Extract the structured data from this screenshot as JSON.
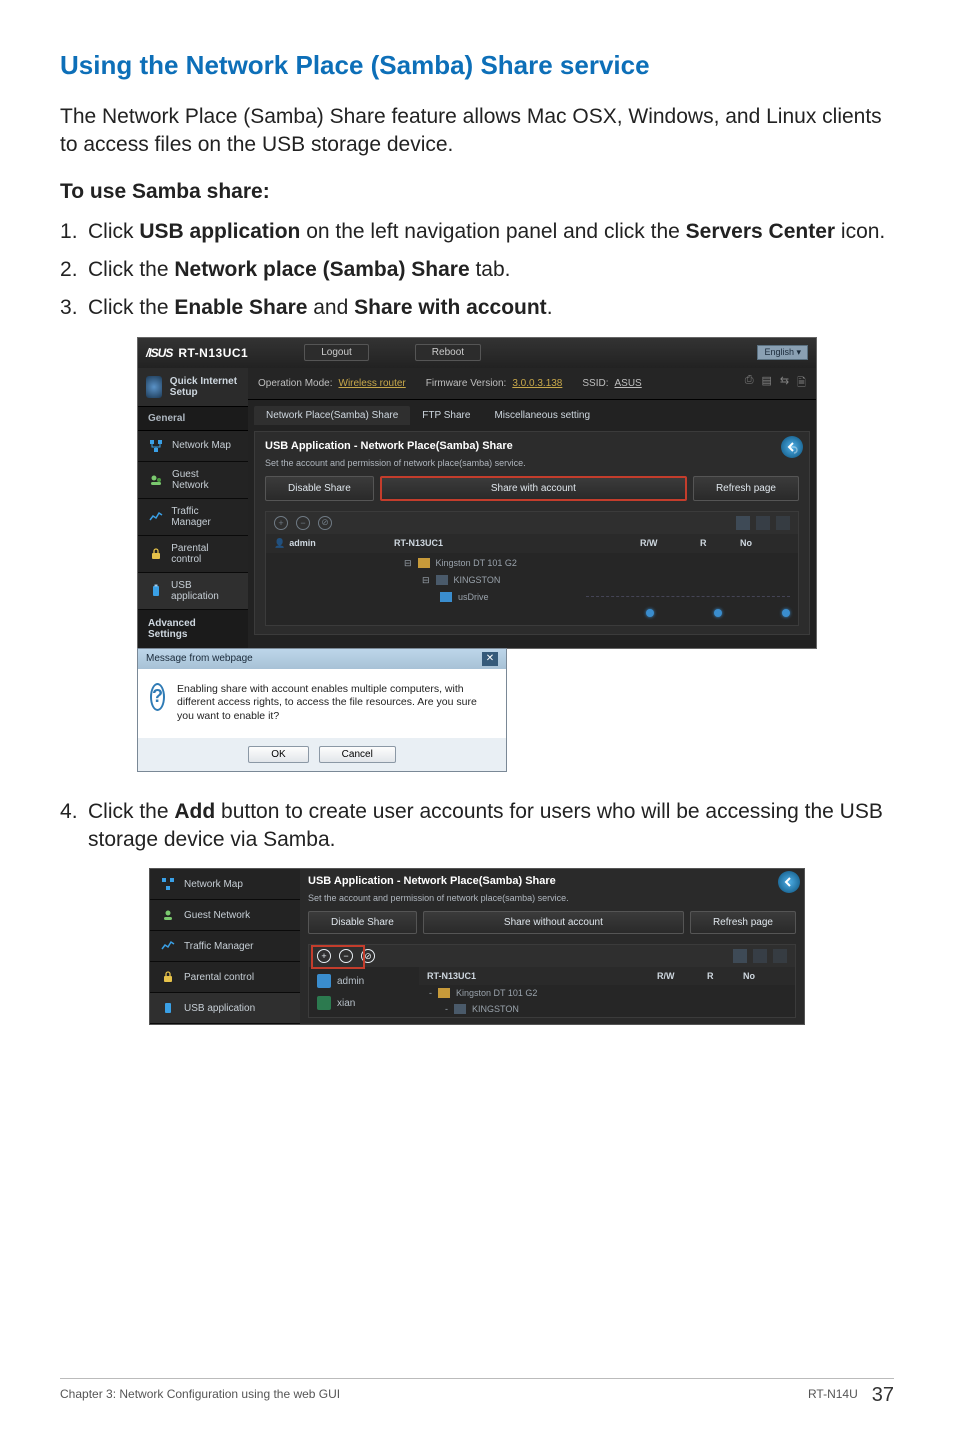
{
  "title": "Using the Network Place (Samba) Share service",
  "intro": "The Network Place (Samba) Share feature allows Mac OSX, Windows, and Linux clients to access files on the USB storage device.",
  "subheading": "To use Samba share:",
  "steps_top": {
    "s1_a": "Click ",
    "s1_b": "USB application",
    "s1_c": " on the left navigation panel and click the ",
    "s1_d": "Servers Center",
    "s1_e": " icon.",
    "s2_a": "Click the ",
    "s2_b": "Network place (Samba) Share",
    "s2_c": " tab.",
    "s3_a": "Click the ",
    "s3_b": "Enable Share",
    "s3_c": " and ",
    "s3_d": "Share with account",
    "s3_e": "."
  },
  "step4_a": "Click the ",
  "step4_b": "Add",
  "step4_c": " button to create user accounts for users who will be accessing the USB storage device via Samba.",
  "router": {
    "brand_text": "RT-N13UC1",
    "logout": "Logout",
    "reboot": "Reboot",
    "language": "English",
    "op_mode_label": "Operation Mode: ",
    "op_mode_value": "Wireless router",
    "fw_label": "Firmware Version: ",
    "fw_value": "3.0.0.3.138",
    "ssid_label": "SSID: ",
    "ssid_value": "ASUS",
    "quick_setup": "Quick Internet Setup",
    "group_general": "General",
    "nav": {
      "network_map": "Network Map",
      "guest_network": "Guest Network",
      "traffic_manager": "Traffic Manager",
      "parental_control": "Parental control",
      "usb_application": "USB application"
    },
    "advanced": "Advanced Settings",
    "tabs": {
      "samba": "Network Place(Samba) Share",
      "ftp": "FTP Share",
      "misc": "Miscellaneous setting"
    },
    "panel_title": "USB Application - Network Place(Samba) Share",
    "panel_sub": "Set the account and permission of network place(samba) service.",
    "btn_disable": "Disable Share",
    "btn_share_acct": "Share with account",
    "btn_refresh": "Refresh page",
    "col_admin": "admin",
    "col_device": "RT-N13UC1",
    "col_rw": "R/W",
    "col_r": "R",
    "col_no": "No",
    "drive1": "Kingston DT 101 G2",
    "drive1_sub": "KINGSTON",
    "drive2": "usDrive"
  },
  "dialog": {
    "title": "Message from webpage",
    "body": "Enabling share with account enables multiple computers, with different access rights, to access the file resources. Are you sure you want to enable it?",
    "ok": "OK",
    "cancel": "Cancel"
  },
  "shot2": {
    "panel_title": "USB Application - Network Place(Samba) Share",
    "panel_sub": "Set the account and permission of network place(samba) service.",
    "btn_disable": "Disable Share",
    "btn_share_without": "Share without account",
    "btn_refresh": "Refresh page",
    "acct1": "admin",
    "acct2": "xian",
    "col_device": "RT-N13UC1",
    "col_rw": "R/W",
    "col_r": "R",
    "col_no": "No",
    "drive1": "Kingston DT 101 G2",
    "drive1_sub": "KINGSTON"
  },
  "footer": {
    "left": "Chapter 3: Network Configuration using the web GUI",
    "model": "RT-N14U",
    "page": "37"
  }
}
